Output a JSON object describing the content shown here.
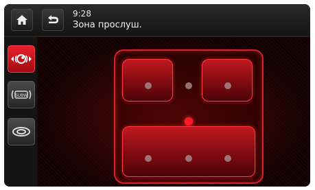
{
  "header": {
    "time": "9:28",
    "title": "Зона прослуш."
  },
  "sidebar": {
    "items": [
      {
        "name": "sound-focus",
        "active": true
      },
      {
        "name": "subwoofer",
        "label": "SUBW",
        "active": false
      },
      {
        "name": "surround",
        "active": false
      }
    ]
  },
  "colors": {
    "accent": "#e8202a",
    "background": "#0b0b0b"
  }
}
